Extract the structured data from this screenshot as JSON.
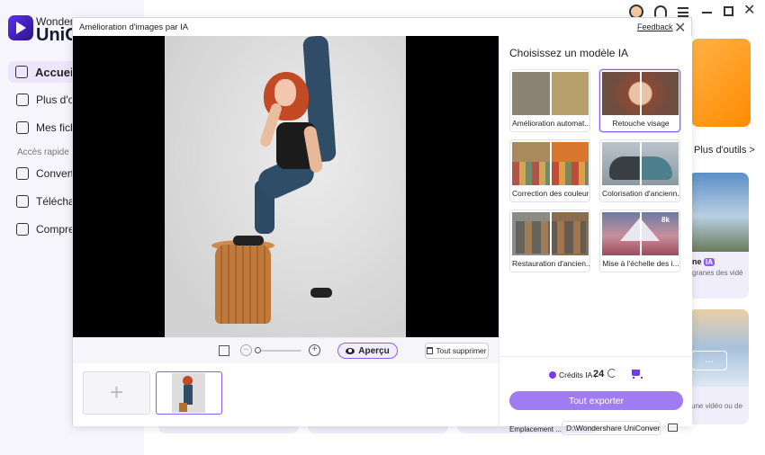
{
  "background_app": {
    "brand_line1": "Wonders",
    "brand_line2": "UniC",
    "nav": [
      {
        "label": "Accueil"
      },
      {
        "label": "Plus d'ou"
      },
      {
        "label": "Mes fichi"
      }
    ],
    "section_label": "Accès rapide",
    "quick": [
      {
        "label": "Converti"
      },
      {
        "label": "Téléchar"
      },
      {
        "label": "Compres"
      }
    ],
    "more_tools": "Plus d'outils >",
    "card_ai_title": "ne",
    "card_ai_badge": "IA",
    "card_ai_sub": "granes des vidé",
    "card_snow_dots": "...",
    "card_snow_sub": "une vidéo ou de"
  },
  "dialog": {
    "title": "Amélioration d'images par IA",
    "feedback": "Feedback",
    "apercu_label": "Aperçu",
    "delete_all_label": "Tout supprimer",
    "add_symbol": "+",
    "panel_title": "Choisissez un modèle IA",
    "models": [
      {
        "label": "Amélioration automat..."
      },
      {
        "label": "Retouche visage"
      },
      {
        "label": "Correction des couleurs"
      },
      {
        "label": "Colorisation d'ancienn..."
      },
      {
        "label": "Restauration d'ancien..."
      },
      {
        "label": "Mise à l'échelle des i..."
      }
    ],
    "badge_8k": "8k",
    "credits_label": "Crédits IA :",
    "credits_value": "24",
    "export_label": "Tout exporter",
    "location_label": "Emplacement ...",
    "location_path": "D:\\Wondershare UniConver"
  }
}
